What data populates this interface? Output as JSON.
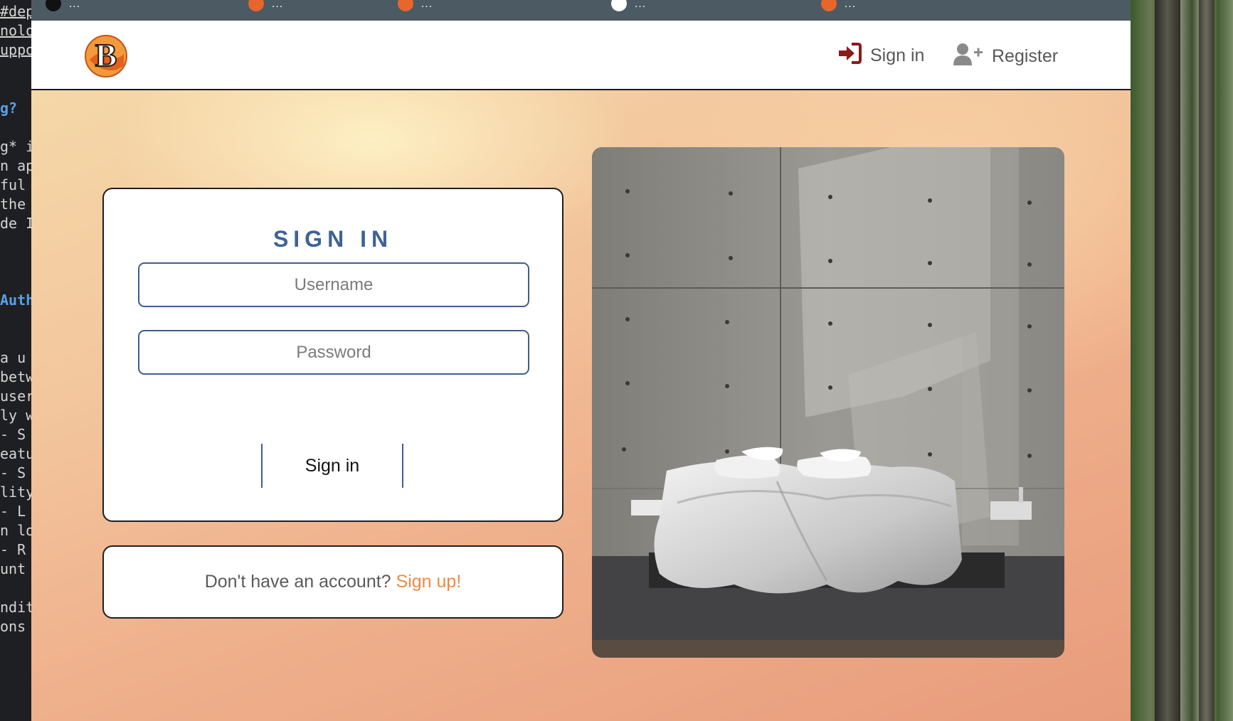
{
  "editor": {
    "lines": [
      {
        "text": "#dep",
        "style": "link"
      },
      {
        "text": "nolo",
        "style": "link"
      },
      {
        "text": "uppo",
        "style": "link"
      },
      {
        "text": "g?",
        "style": "blue"
      },
      {
        "text": "g* i",
        "style": "plain"
      },
      {
        "text": "n ap",
        "style": "plain"
      },
      {
        "text": "ful",
        "style": "plain"
      },
      {
        "text": "the",
        "style": "plain"
      },
      {
        "text": "de I",
        "style": "plain"
      },
      {
        "text": "Auth",
        "style": "blue"
      },
      {
        "text": " a u",
        "style": "plain"
      },
      {
        "text": "betw",
        "style": "plain"
      },
      {
        "text": "user",
        "style": "plain"
      },
      {
        "text": "ly w",
        "style": "plain"
      },
      {
        "text": " - S",
        "style": "plain"
      },
      {
        "text": "eatu",
        "style": "plain"
      },
      {
        "text": " - S",
        "style": "plain"
      },
      {
        "text": "lity",
        "style": "plain"
      },
      {
        "text": " - L",
        "style": "plain"
      },
      {
        "text": "n lo",
        "style": "plain"
      },
      {
        "text": " - R",
        "style": "plain"
      },
      {
        "text": " unt",
        "style": "plain"
      },
      {
        "text": "ndit",
        "style": "plain"
      },
      {
        "text": "ons",
        "style": "plain"
      }
    ]
  },
  "bookmarks": [
    {
      "label": "…",
      "icon_color": "#111111"
    },
    {
      "label": "…",
      "icon_color": "#e8662c"
    },
    {
      "label": "…",
      "icon_color": "#e8662c"
    },
    {
      "label": "…",
      "icon_color": "#ffffff"
    },
    {
      "label": "…",
      "icon_color": "#e8662c"
    }
  ],
  "navbar": {
    "logo_letter": "B",
    "signin_label": "Sign in",
    "register_label": "Register",
    "signin_icon": "sign-in-icon",
    "register_icon": "user-plus-icon",
    "signin_icon_color": "#8b1a1a",
    "register_icon_color": "#8a8a8a"
  },
  "signin_form": {
    "title": "SIGN IN",
    "username_placeholder": "Username",
    "password_placeholder": "Password",
    "submit_label": "Sign in"
  },
  "signup_prompt": {
    "text": "Don't have an account?",
    "link_label": "Sign up!"
  },
  "colors": {
    "accent_blue": "#3f6394",
    "link_orange": "#ee8a42",
    "bookmarks_bar": "#4b5a63"
  }
}
